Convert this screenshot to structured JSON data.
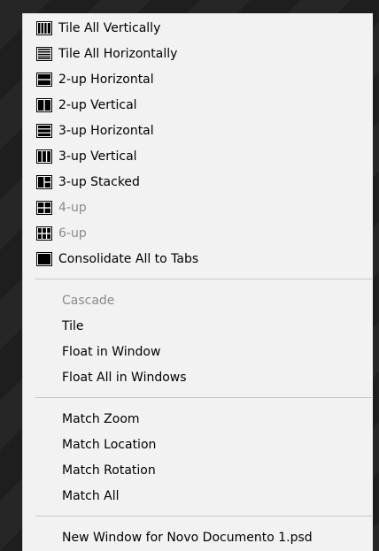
{
  "menu": {
    "items": [
      {
        "label": "Tile All Vertically",
        "icon": "tile-all-vertically-icon",
        "enabled": true
      },
      {
        "label": "Tile All Horizontally",
        "icon": "tile-all-horizontally-icon",
        "enabled": true
      },
      {
        "label": "2-up Horizontal",
        "icon": "two-up-horizontal-icon",
        "enabled": true
      },
      {
        "label": "2-up Vertical",
        "icon": "two-up-vertical-icon",
        "enabled": true
      },
      {
        "label": "3-up Horizontal",
        "icon": "three-up-horizontal-icon",
        "enabled": true
      },
      {
        "label": "3-up Vertical",
        "icon": "three-up-vertical-icon",
        "enabled": true
      },
      {
        "label": "3-up Stacked",
        "icon": "three-up-stacked-icon",
        "enabled": true
      },
      {
        "label": "4-up",
        "icon": "four-up-icon",
        "enabled": false
      },
      {
        "label": "6-up",
        "icon": "six-up-icon",
        "enabled": false
      },
      {
        "label": "Consolidate All to Tabs",
        "icon": "consolidate-tabs-icon",
        "enabled": true
      },
      {
        "label": "Cascade",
        "enabled": false
      },
      {
        "label": "Tile",
        "enabled": true
      },
      {
        "label": "Float in Window",
        "enabled": true
      },
      {
        "label": "Float All in Windows",
        "enabled": true
      },
      {
        "label": "Match Zoom",
        "enabled": true
      },
      {
        "label": "Match Location",
        "enabled": true
      },
      {
        "label": "Match Rotation",
        "enabled": true
      },
      {
        "label": "Match All",
        "enabled": true
      },
      {
        "label": "New Window for Novo Documento 1.psd",
        "enabled": true
      }
    ]
  },
  "colors": {
    "menu_background": "#f2f2f2",
    "text": "#000000",
    "disabled_text": "#8a8a8a",
    "separator": "#c9c9c9"
  }
}
